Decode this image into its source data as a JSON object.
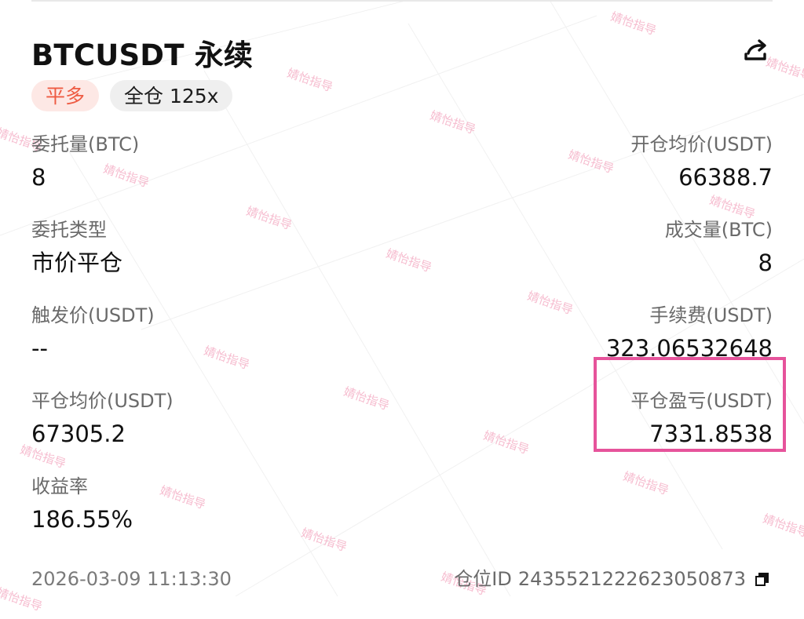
{
  "header": {
    "title": "BTCUSDT 永续",
    "share_icon": "share-icon"
  },
  "badges": {
    "side": "平多",
    "margin": "全仓 125x"
  },
  "fields": {
    "order_qty": {
      "label": "委托量(BTC)",
      "value": "8"
    },
    "avg_open_price": {
      "label": "开仓均价(USDT)",
      "value": "66388.7"
    },
    "order_type": {
      "label": "委托类型",
      "value": "市价平仓"
    },
    "filled_qty": {
      "label": "成交量(BTC)",
      "value": "8"
    },
    "trigger_price": {
      "label": "触发价(USDT)",
      "value": "--"
    },
    "fee": {
      "label": "手续费(USDT)",
      "value": "323.06532648"
    },
    "avg_close_price": {
      "label": "平仓均价(USDT)",
      "value": "67305.2"
    },
    "realized_pnl": {
      "label": "平仓盈亏(USDT)",
      "value": "7331.8538"
    },
    "roi": {
      "label": "收益率",
      "value": "186.55%"
    }
  },
  "footer": {
    "timestamp": "2026-03-09 11:13:30",
    "position_id_label": "仓位ID",
    "position_id": "2435521222623050873",
    "copy_icon": "copy-icon"
  },
  "watermark": {
    "text": "婧怡指导",
    "color": "#f3a3bd"
  },
  "colors": {
    "highlight": "#e6539b",
    "side_badge_bg": "#fde8e5",
    "side_badge_text": "#ee5b43",
    "margin_badge_bg": "#efefef"
  }
}
